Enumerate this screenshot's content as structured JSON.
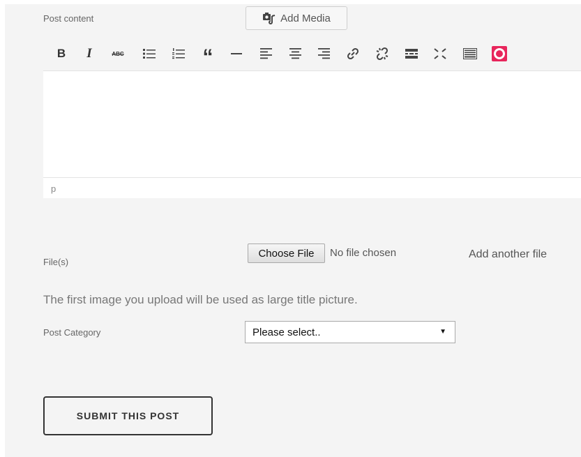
{
  "editor": {
    "post_content_label": "Post content",
    "add_media_label": "Add Media",
    "toolbar_icons": [
      "bold-icon",
      "italic-icon",
      "strikethrough-icon",
      "bulleted-list-icon",
      "numbered-list-icon",
      "blockquote-icon",
      "horizontal-line-icon",
      "align-left-icon",
      "align-center-icon",
      "align-right-icon",
      "link-icon",
      "unlink-icon",
      "read-more-icon",
      "fullscreen-icon",
      "toolbar-toggle-icon",
      "record-icon"
    ],
    "bold_glyph": "B",
    "italic_glyph": "I",
    "strike_glyph": "ABC",
    "quote_glyph": "“",
    "record_color": "#e8265c",
    "content": "",
    "status_path": "p"
  },
  "files": {
    "label": "File(s)",
    "choose_button": "Choose File",
    "no_file_text": "No file chosen",
    "add_another": "Add another file",
    "notice": "The first image you upload will be used as large title picture."
  },
  "category": {
    "label": "Post Category",
    "selected": "Please select.."
  },
  "submit_label": "SUBMIT THIS POST"
}
